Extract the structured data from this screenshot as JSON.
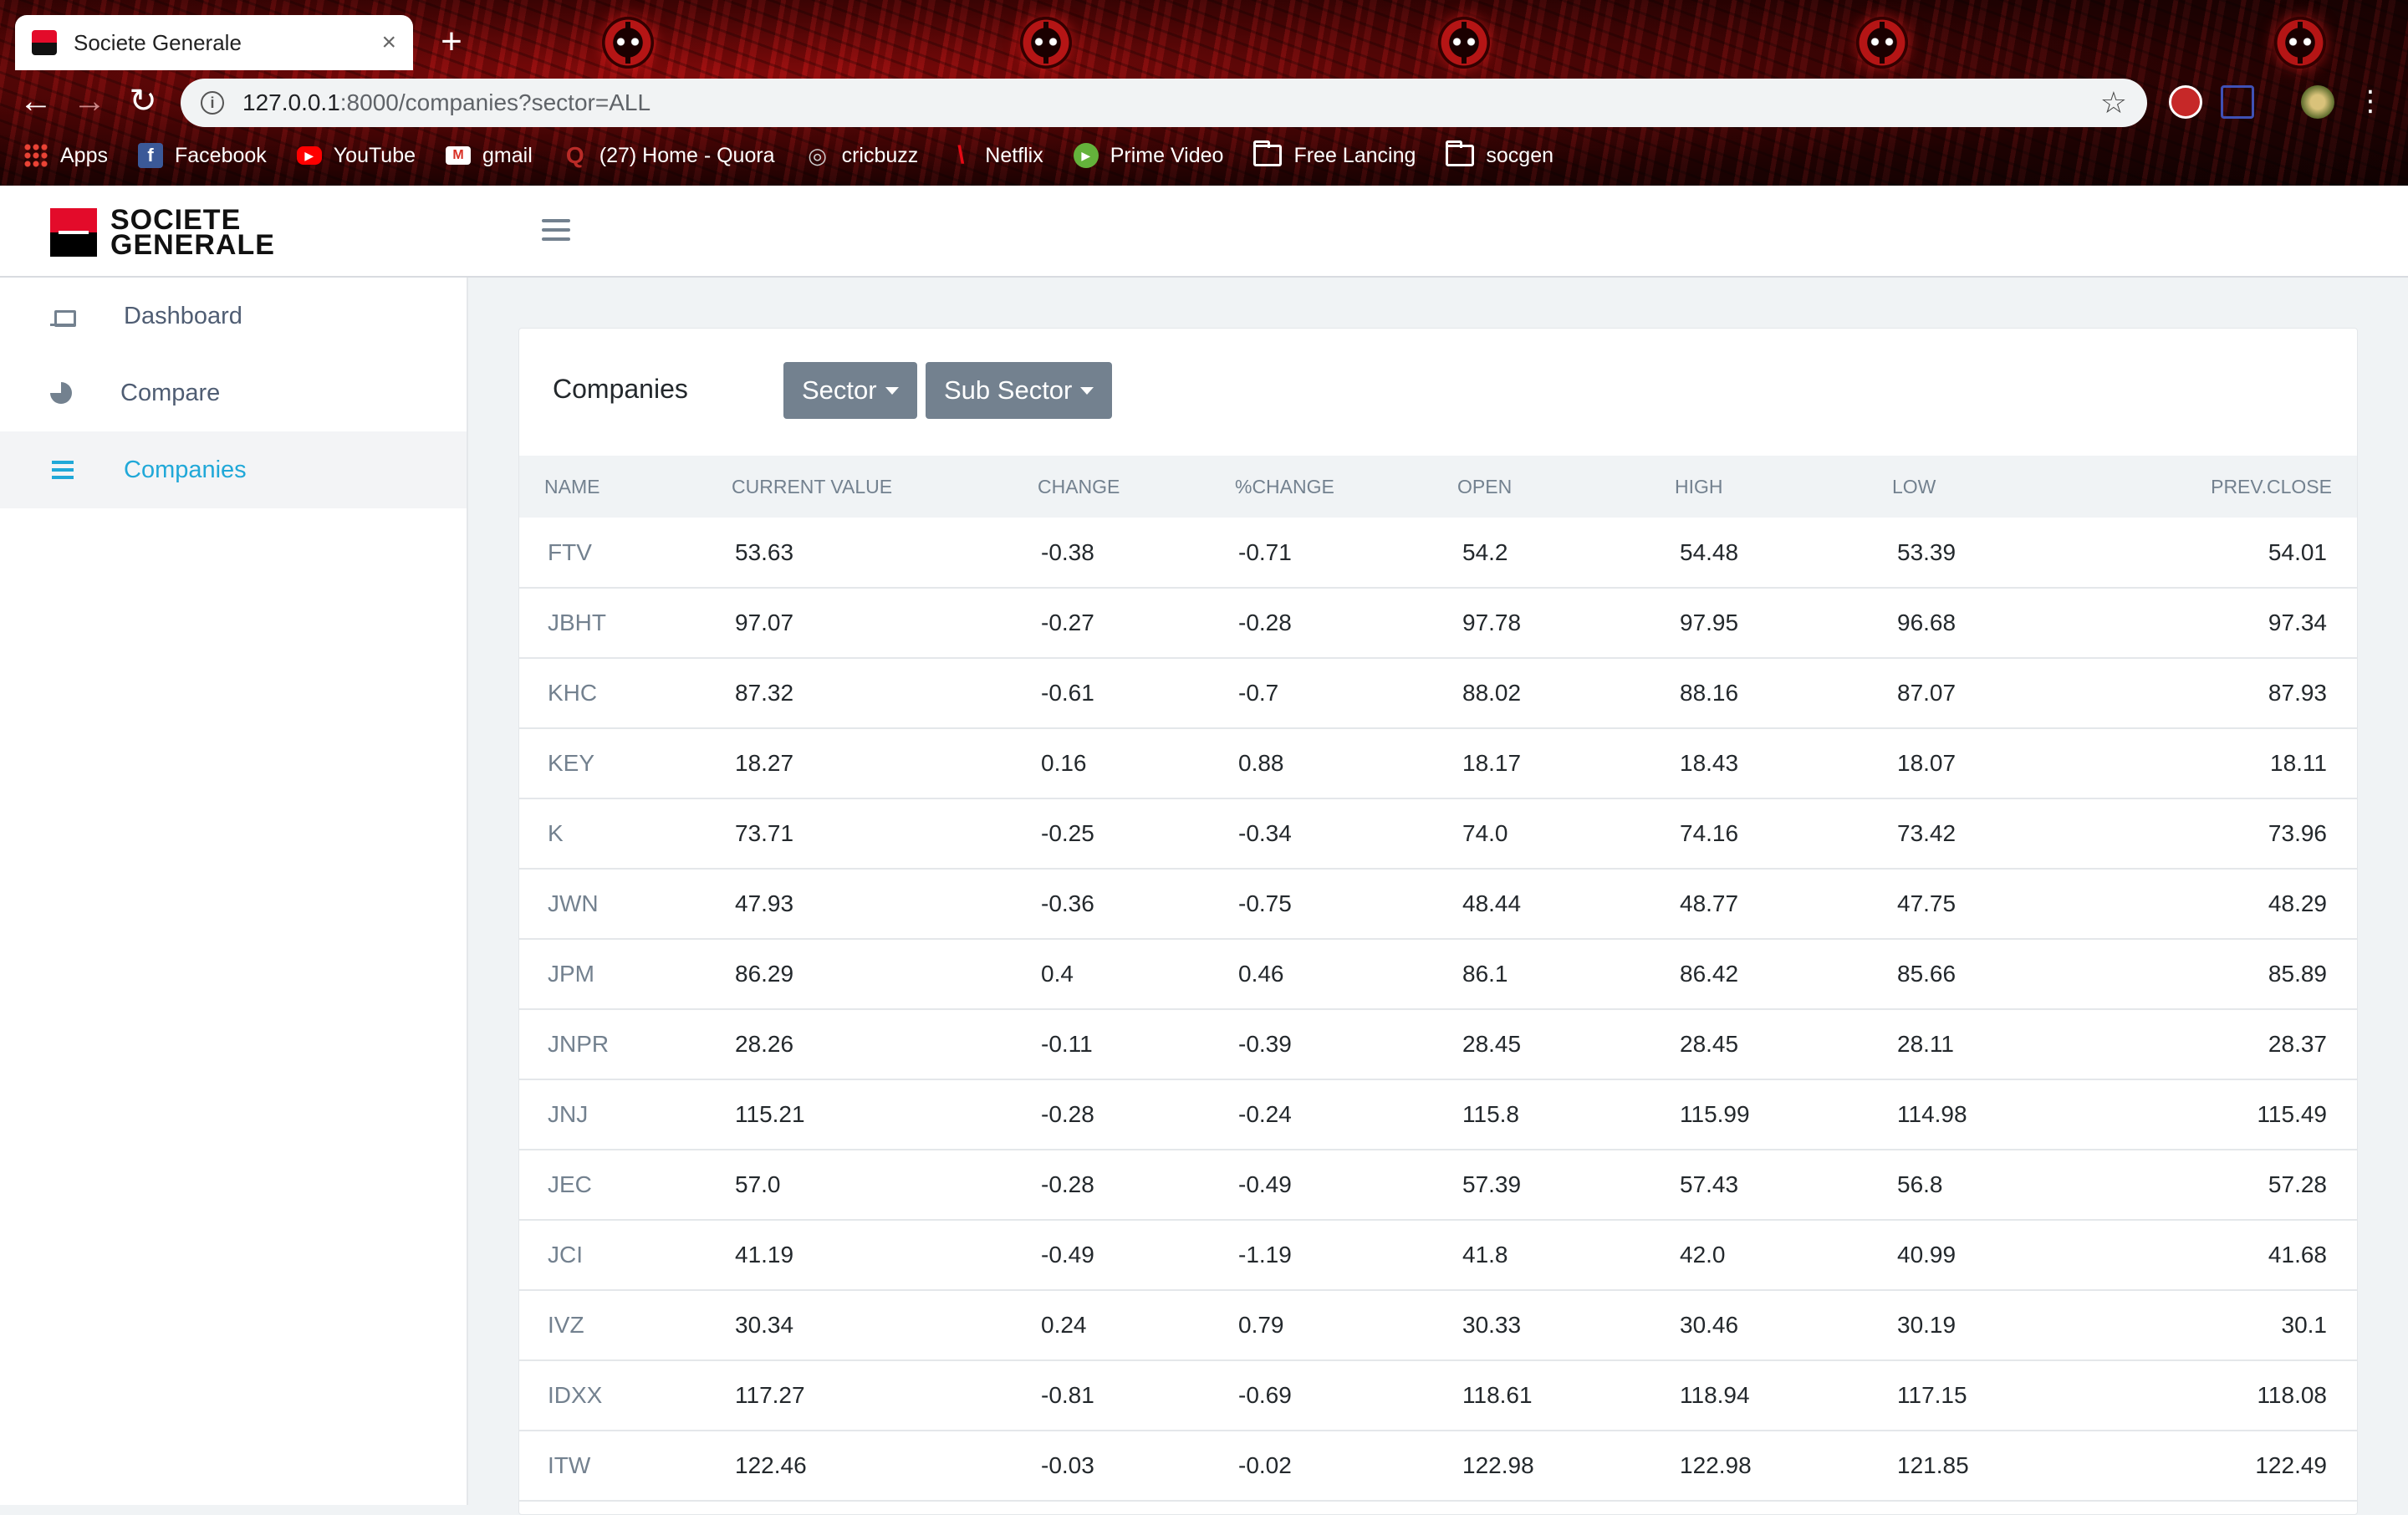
{
  "browser": {
    "tab_title": "Societe Generale",
    "url_host": "127.0.0.1",
    "url_path": ":8000/companies?sector=ALL",
    "bookmarks": [
      {
        "label": "Apps",
        "icon": "apps-grid-icon"
      },
      {
        "label": "Facebook",
        "icon": "facebook-icon"
      },
      {
        "label": "YouTube",
        "icon": "youtube-icon"
      },
      {
        "label": "gmail",
        "icon": "gmail-icon"
      },
      {
        "label": "(27) Home - Quora",
        "icon": "quora-icon"
      },
      {
        "label": "cricbuzz",
        "icon": "cricbuzz-icon"
      },
      {
        "label": "Netflix",
        "icon": "netflix-icon"
      },
      {
        "label": "Prime Video",
        "icon": "prime-video-icon"
      },
      {
        "label": "Free Lancing",
        "icon": "folder-icon"
      },
      {
        "label": "socgen",
        "icon": "folder-icon"
      }
    ]
  },
  "header": {
    "logo_line1": "SOCIETE",
    "logo_line2": "GENERALE"
  },
  "sidebar": {
    "items": [
      {
        "label": "Dashboard",
        "icon": "laptop-icon",
        "active": false
      },
      {
        "label": "Compare",
        "icon": "pie-chart-icon",
        "active": false
      },
      {
        "label": "Companies",
        "icon": "list-icon",
        "active": true
      }
    ]
  },
  "main": {
    "title": "Companies",
    "sector_button": "Sector",
    "subsector_button": "Sub Sector",
    "columns": [
      "NAME",
      "CURRENT VALUE",
      "CHANGE",
      "%CHANGE",
      "OPEN",
      "HIGH",
      "LOW",
      "PREV.CLOSE"
    ],
    "rows": [
      [
        "FTV",
        "53.63",
        "-0.38",
        "-0.71",
        "54.2",
        "54.48",
        "53.39",
        "54.01"
      ],
      [
        "JBHT",
        "97.07",
        "-0.27",
        "-0.28",
        "97.78",
        "97.95",
        "96.68",
        "97.34"
      ],
      [
        "KHC",
        "87.32",
        "-0.61",
        "-0.7",
        "88.02",
        "88.16",
        "87.07",
        "87.93"
      ],
      [
        "KEY",
        "18.27",
        "0.16",
        "0.88",
        "18.17",
        "18.43",
        "18.07",
        "18.11"
      ],
      [
        "K",
        "73.71",
        "-0.25",
        "-0.34",
        "74.0",
        "74.16",
        "73.42",
        "73.96"
      ],
      [
        "JWN",
        "47.93",
        "-0.36",
        "-0.75",
        "48.44",
        "48.77",
        "47.75",
        "48.29"
      ],
      [
        "JPM",
        "86.29",
        "0.4",
        "0.46",
        "86.1",
        "86.42",
        "85.66",
        "85.89"
      ],
      [
        "JNPR",
        "28.26",
        "-0.11",
        "-0.39",
        "28.45",
        "28.45",
        "28.11",
        "28.37"
      ],
      [
        "JNJ",
        "115.21",
        "-0.28",
        "-0.24",
        "115.8",
        "115.99",
        "114.98",
        "115.49"
      ],
      [
        "JEC",
        "57.0",
        "-0.28",
        "-0.49",
        "57.39",
        "57.43",
        "56.8",
        "57.28"
      ],
      [
        "JCI",
        "41.19",
        "-0.49",
        "-1.19",
        "41.8",
        "42.0",
        "40.99",
        "41.68"
      ],
      [
        "IVZ",
        "30.34",
        "0.24",
        "0.79",
        "30.33",
        "30.46",
        "30.19",
        "30.1"
      ],
      [
        "IDXX",
        "117.27",
        "-0.81",
        "-0.69",
        "118.61",
        "118.94",
        "117.15",
        "118.08"
      ],
      [
        "ITW",
        "122.46",
        "-0.03",
        "-0.02",
        "122.98",
        "122.98",
        "121.85",
        "122.49"
      ]
    ]
  },
  "colors": {
    "brand_red": "#e30b2a",
    "accent_blue": "#20a8d8",
    "button_gray": "#73818f"
  }
}
